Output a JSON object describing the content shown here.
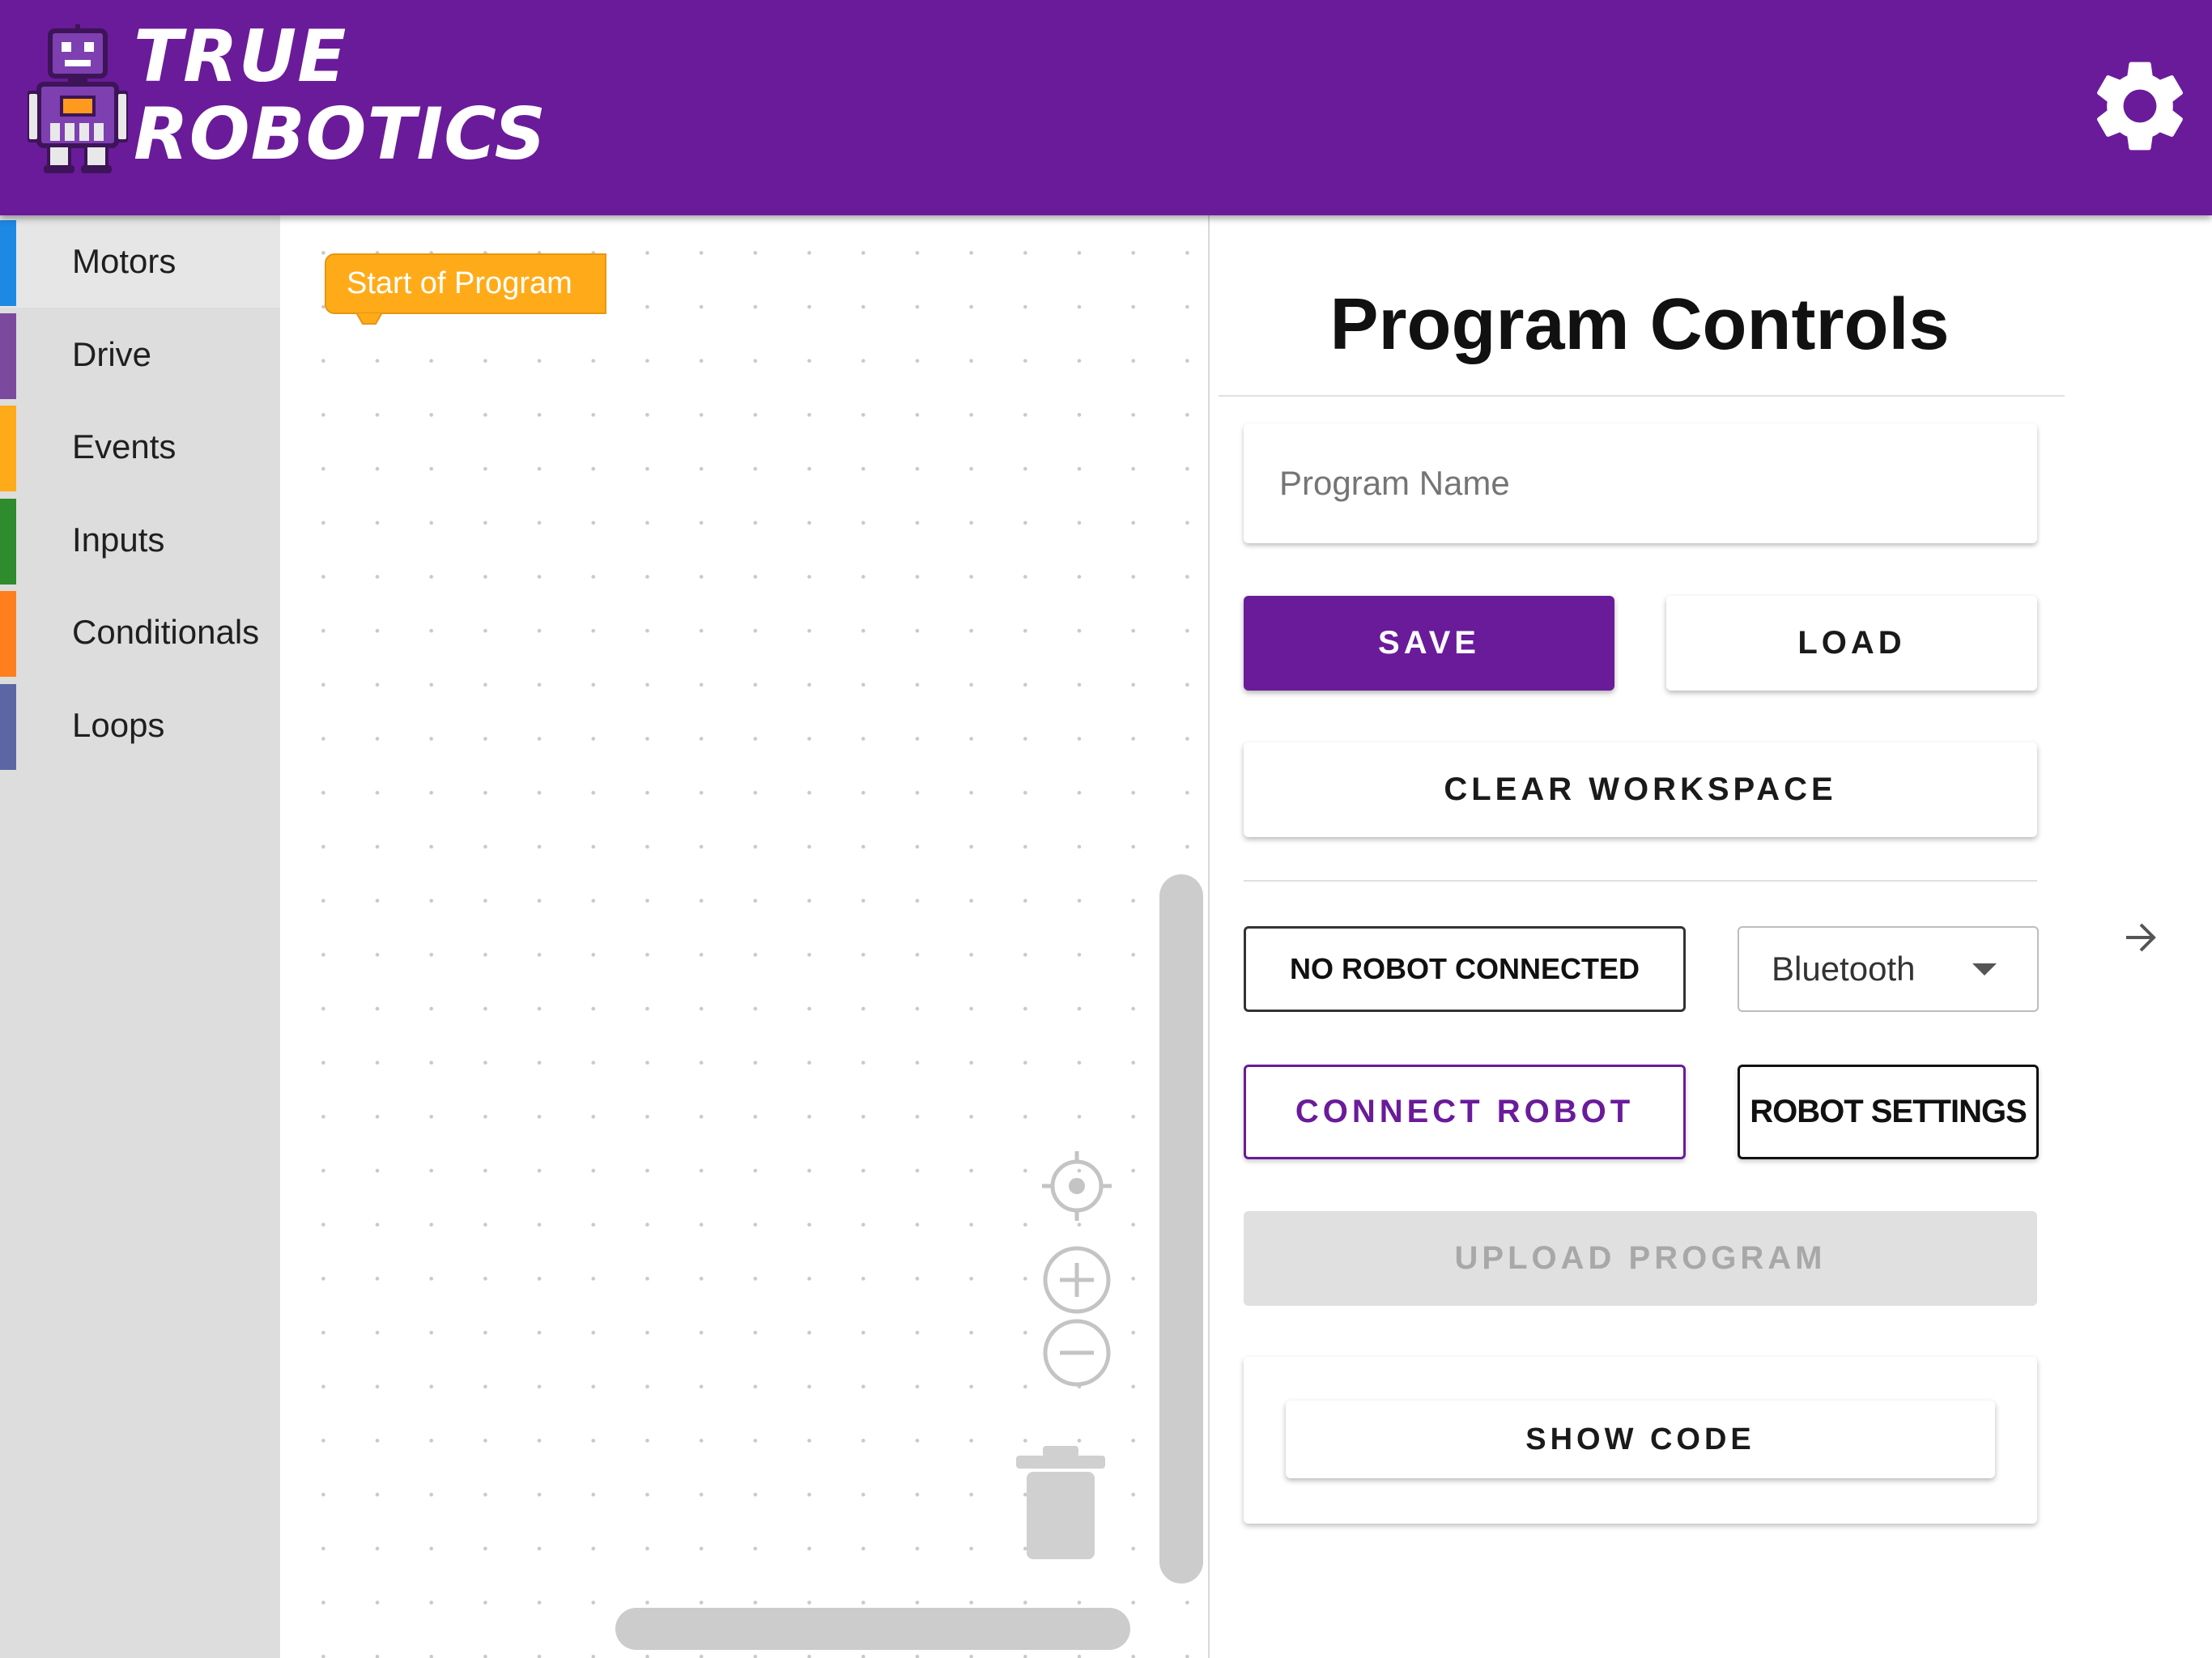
{
  "header": {
    "logo_line1": "TRUE",
    "logo_line2": "ROBOTICS",
    "bg_color": "#6a1b9a",
    "settings_icon": "gear-icon"
  },
  "sidebar": {
    "categories": [
      {
        "label": "Motors",
        "color": "#1e88e5"
      },
      {
        "label": "Drive",
        "color": "#7b4a9e"
      },
      {
        "label": "Events",
        "color": "#ffab19"
      },
      {
        "label": "Inputs",
        "color": "#2e8b2e"
      },
      {
        "label": "Conditionals",
        "color": "#ff7f1e"
      },
      {
        "label": "Loops",
        "color": "#5b67a5"
      }
    ],
    "selected": "Motors"
  },
  "workspace": {
    "start_block_label": "Start of Program",
    "start_block_color": "#ffab19",
    "controls": [
      "reset-view-icon",
      "zoom-in-icon",
      "zoom-out-icon",
      "trash-icon"
    ]
  },
  "panel": {
    "title": "Program Controls",
    "program_name_placeholder": "Program Name",
    "save_label": "SAVE",
    "load_label": "LOAD",
    "clear_label": "CLEAR WORKSPACE",
    "status_label": "NO ROBOT CONNECTED",
    "connection_type": "Bluetooth",
    "connect_label": "CONNECT ROBOT",
    "robot_settings_label": "ROBOT SETTINGS",
    "upload_label": "UPLOAD PROGRAM",
    "show_code_label": "SHOW CODE",
    "accent_color": "#6a1b9a"
  }
}
